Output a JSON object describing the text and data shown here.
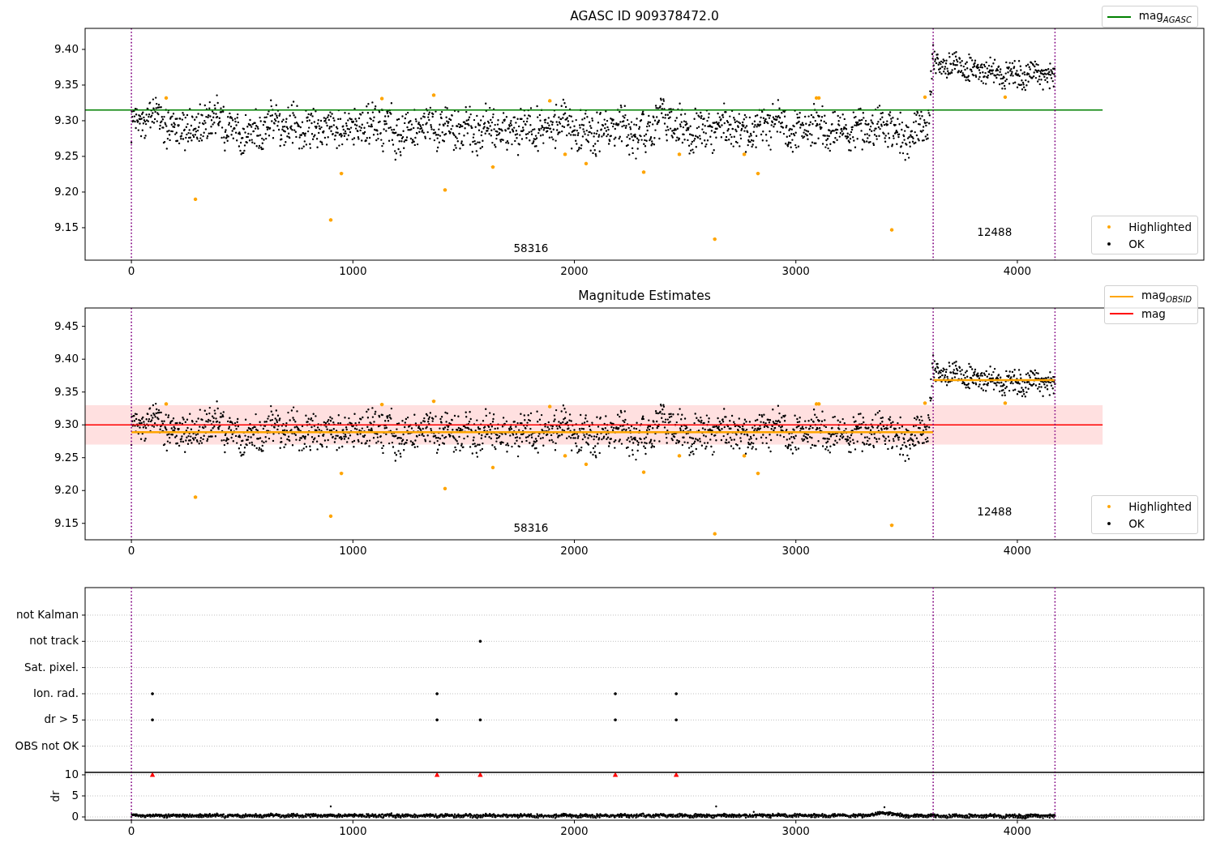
{
  "panels": [
    {
      "chart_data": {
        "type": "scatter",
        "title": "AGASC ID 909378472.0",
        "xlim": [
          -209,
          4842
        ],
        "ylim": [
          9.1045,
          9.4295
        ],
        "xticks": [
          0,
          1000,
          2000,
          3000,
          4000
        ],
        "yticks": [
          {
            "value": 9.15,
            "label": "9.15"
          },
          {
            "value": 9.2,
            "label": "9.20"
          },
          {
            "value": 9.25,
            "label": "9.25"
          },
          {
            "value": 9.3,
            "label": "9.30"
          },
          {
            "value": 9.35,
            "label": "9.35"
          },
          {
            "value": 9.4,
            "label": "9.40"
          }
        ],
        "series": [
          {
            "type": "scatter",
            "color": "#ffa500",
            "x": [
              157,
              289,
              900,
              948,
              1131,
              1365,
              1416,
              1632,
              1889,
              1958,
              2053,
              2313,
              2474,
              2634,
              2767,
              2829,
              3093,
              3104,
              3433,
              3583,
              3945
            ],
            "values": [
              9.332,
              9.19,
              9.161,
              9.226,
              9.331,
              9.336,
              9.203,
              9.235,
              9.328,
              9.253,
              9.24,
              9.228,
              9.253,
              9.134,
              9.253,
              9.226,
              9.332,
              9.332,
              9.147,
              9.333,
              9.333
            ]
          },
          {
            "type": "line",
            "color": "#008000",
            "x": [
              -209,
              4385
            ],
            "values": [
              9.315,
              9.315
            ]
          }
        ],
        "ref_lines": [
          {
            "axis": "x",
            "value": 0,
            "color": "#800080"
          },
          {
            "axis": "x",
            "value": 3620,
            "color": "#800080"
          },
          {
            "axis": "x",
            "value": 4170,
            "color": "#800080"
          }
        ],
        "annotations": [
          "58316",
          "12488"
        ]
      },
      "legend_upper": [
        {
          "label": "mag$_{AGASC}$",
          "kind": "line",
          "color": "#008000"
        }
      ],
      "legend_lower": [
        {
          "label": "Highlighted",
          "kind": "dot",
          "color": "#ffa500"
        },
        {
          "label": "OK",
          "kind": "dot",
          "color": "#000000"
        }
      ]
    },
    {
      "chart_data": {
        "type": "scatter",
        "title": "Magnitude Estimates",
        "xlim": [
          -209,
          4842
        ],
        "ylim": [
          9.125,
          9.478
        ],
        "xticks": [
          0,
          1000,
          2000,
          3000,
          4000
        ],
        "yticks": [
          {
            "value": 9.15,
            "label": "9.15"
          },
          {
            "value": 9.2,
            "label": "9.20"
          },
          {
            "value": 9.25,
            "label": "9.25"
          },
          {
            "value": 9.3,
            "label": "9.30"
          },
          {
            "value": 9.35,
            "label": "9.35"
          },
          {
            "value": 9.4,
            "label": "9.40"
          },
          {
            "value": 9.45,
            "label": "9.45"
          }
        ],
        "bands": [
          {
            "axis": "y",
            "from": 9.27,
            "to": 9.33,
            "color": "#ffe0e0"
          }
        ],
        "series": [
          {
            "type": "scatter",
            "color": "#ffa500",
            "x": [
              157,
              289,
              900,
              948,
              1131,
              1365,
              1416,
              1632,
              1889,
              1958,
              2053,
              2313,
              2474,
              2634,
              2767,
              2829,
              3093,
              3104,
              3433,
              3583,
              3945
            ],
            "values": [
              9.332,
              9.19,
              9.161,
              9.226,
              9.331,
              9.336,
              9.203,
              9.235,
              9.328,
              9.253,
              9.24,
              9.228,
              9.253,
              9.134,
              9.253,
              9.226,
              9.332,
              9.332,
              9.147,
              9.333,
              9.333
            ]
          },
          {
            "type": "line",
            "color": "#ffa500",
            "x": [
              0,
              3620
            ],
            "values": [
              9.289,
              9.289
            ]
          },
          {
            "type": "line",
            "color": "#ffa500",
            "x": [
              3620,
              4170
            ],
            "values": [
              9.368,
              9.368
            ]
          },
          {
            "type": "line",
            "color": "#ff0000",
            "x": [
              -209,
              4385
            ],
            "values": [
              9.3,
              9.3
            ]
          }
        ],
        "ref_lines": [
          {
            "axis": "x",
            "value": 0,
            "color": "#800080"
          },
          {
            "axis": "x",
            "value": 3620,
            "color": "#800080"
          },
          {
            "axis": "x",
            "value": 4170,
            "color": "#800080"
          }
        ],
        "annotations": [
          "58316",
          "12488"
        ]
      },
      "legend_upper": [
        {
          "label": "mag$_{OBSID}$",
          "kind": "line",
          "color": "#ffa500"
        },
        {
          "label": "mag",
          "kind": "line",
          "color": "#ff0000"
        }
      ],
      "legend_lower": [
        {
          "label": "Highlighted",
          "kind": "dot",
          "color": "#ffa500"
        },
        {
          "label": "OK",
          "kind": "dot",
          "color": "#000000"
        }
      ]
    },
    {
      "chart_data": {
        "type": "scatter",
        "orientation": "horizontal",
        "grid": true,
        "xlim": [
          -209,
          4842
        ],
        "categories": [
          "not Kalman",
          "not track",
          "Sat. pixel.",
          "Ion. rad.",
          "dr > 5",
          "OBS not OK"
        ],
        "series": [
          {
            "color": "#000000",
            "values": [
              null,
              null,
              null,
              95,
              95,
              null
            ]
          },
          {
            "color": "#000000",
            "values": [
              null,
              null,
              null,
              1380,
              1380,
              null
            ]
          },
          {
            "color": "#000000",
            "values": [
              null,
              1575,
              null,
              null,
              1575,
              null
            ]
          },
          {
            "color": "#000000",
            "values": [
              null,
              null,
              null,
              2185,
              2185,
              null
            ]
          },
          {
            "color": "#000000",
            "values": [
              null,
              null,
              null,
              2460,
              2460,
              null
            ]
          }
        ]
      }
    },
    {
      "chart_data": {
        "type": "scatter",
        "grid": true,
        "xlim": [
          -209,
          4842
        ],
        "ylim": [
          -0.77,
          10.58
        ],
        "ylabel": "dr",
        "xticks": [
          0,
          1000,
          2000,
          3000,
          4000
        ],
        "yticks": [
          0,
          5,
          10
        ],
        "series": [
          {
            "color": "#ff0000",
            "x": [
              95,
              1380,
              1575,
              2185,
              2460
            ],
            "values": [
              10,
              10,
              10,
              10,
              10
            ]
          }
        ],
        "ref_lines": [
          {
            "axis": "x",
            "value": 0,
            "color": "#800080"
          },
          {
            "axis": "x",
            "value": 3620,
            "color": "#800080"
          },
          {
            "axis": "x",
            "value": 4170,
            "color": "#800080"
          }
        ]
      }
    }
  ]
}
